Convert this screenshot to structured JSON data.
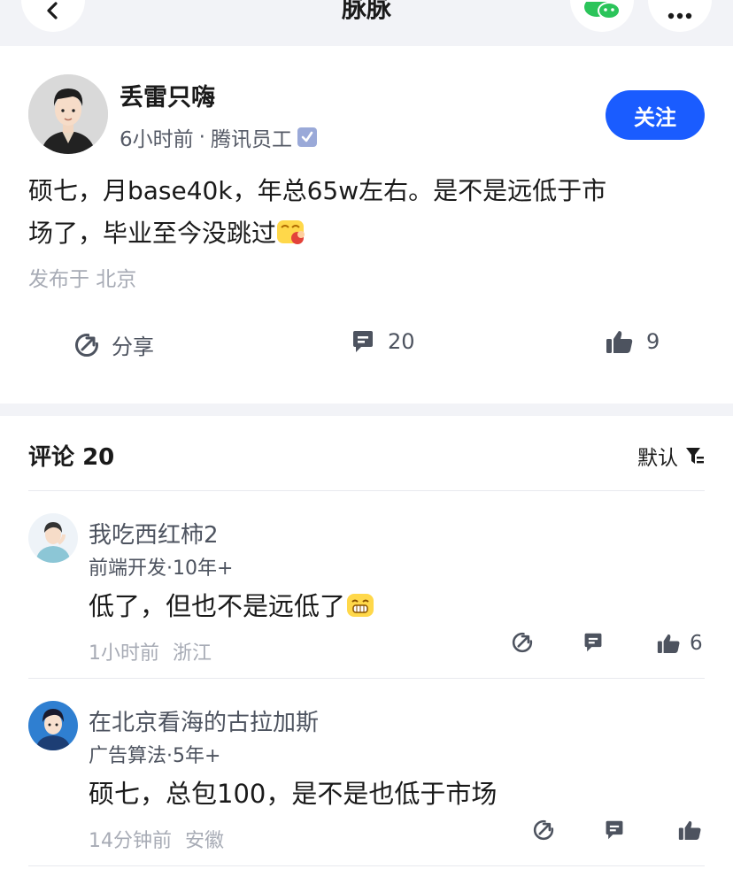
{
  "app": {
    "title": "脉脉"
  },
  "post": {
    "author_name": "丢雷只嗨",
    "time": "6小时前",
    "meta_sep": "·",
    "company": "腾讯员工",
    "follow_label": "关注",
    "content_line1": "硕七，月base40k，年总65w左右。是不是远低于市",
    "content_line2": "场了，毕业至今没跳过",
    "location": "发布于 北京",
    "actions": {
      "share_label": "分享",
      "comment_count": "20",
      "like_count": "9"
    }
  },
  "comments": {
    "header_label": "评论",
    "count": "20",
    "sort_label": "默认",
    "items": [
      {
        "name": "我吃西红柿2",
        "meta": "前端开发·10年+",
        "text": "低了，但也不是远低了",
        "time": "1小时前",
        "location": "浙江",
        "likes": "6"
      },
      {
        "name": "在北京看海的古拉加斯",
        "meta": "广告算法·5年+",
        "text": "硕七，总包100，是不是也低于市场",
        "time": "14分钟前",
        "location": "安徽",
        "likes": ""
      }
    ]
  },
  "colors": {
    "accent": "#1a5cff",
    "background_band": "#f2f3f7",
    "muted_text": "#a7abb5",
    "icon_gray": "#4d535f"
  },
  "icons": [
    "back-icon",
    "wechat-icon",
    "more-icon",
    "verified-icon",
    "share-icon",
    "comment-icon",
    "thumbs-up-icon",
    "filter-icon",
    "emoji-icon"
  ]
}
